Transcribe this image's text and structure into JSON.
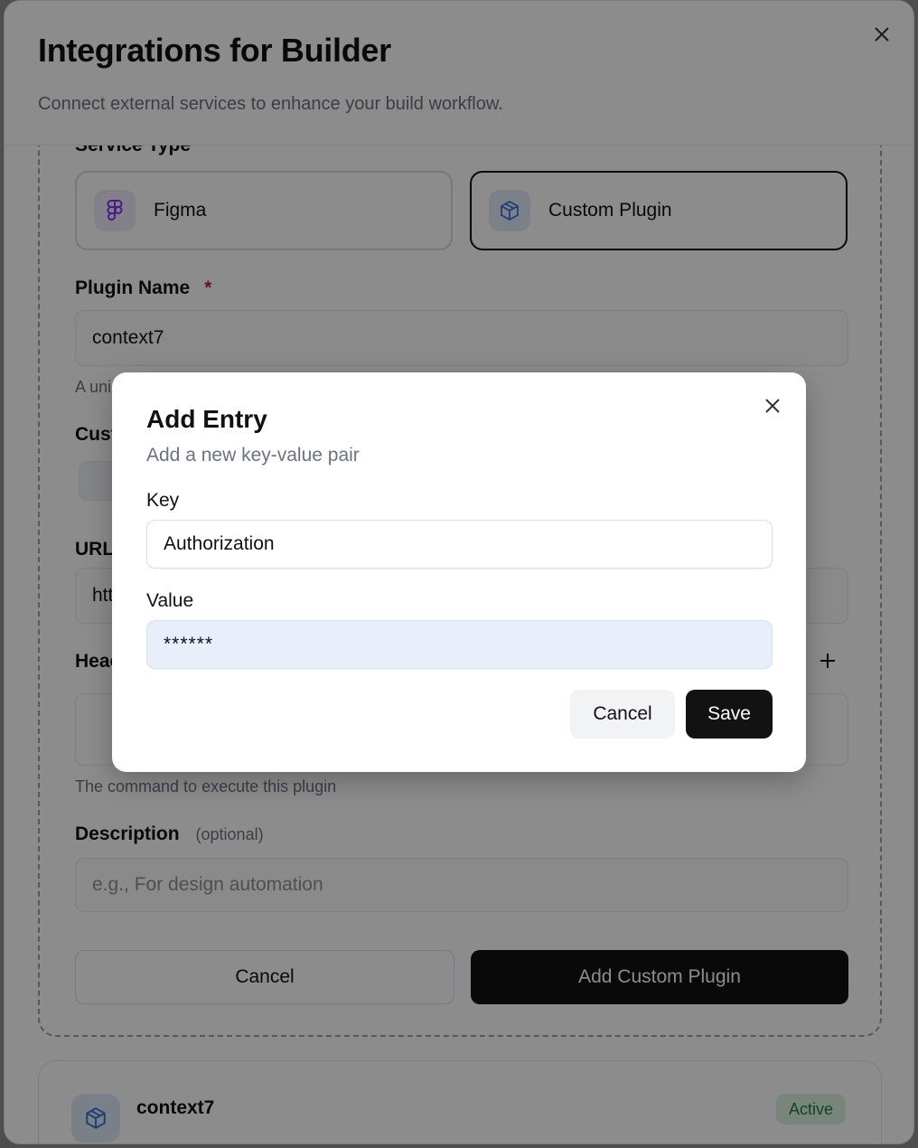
{
  "panel": {
    "title": "Integrations for Builder",
    "subtitle": "Connect external services to enhance your build workflow."
  },
  "form": {
    "service_type_label": "Service Type",
    "services": [
      {
        "label": "Figma",
        "icon": "figma-icon",
        "selected": false
      },
      {
        "label": "Custom Plugin",
        "icon": "box-icon",
        "selected": true
      }
    ],
    "plugin_name_label": "Plugin Name",
    "required_marker": "*",
    "plugin_name_value": "context7",
    "plugin_name_hint": "A uni",
    "custom_label": "Cust",
    "url_label": "URL",
    "url_value": "htt",
    "headers_label": "Heac",
    "command_hint": "The command to execute this plugin",
    "description_label": "Description",
    "description_optional": "(optional)",
    "description_placeholder": "e.g., For design automation",
    "cancel_label": "Cancel",
    "add_label": "Add Custom Plugin"
  },
  "plugin_list": {
    "items": [
      {
        "name": "context7",
        "status": "Active",
        "icon": "box-icon"
      }
    ]
  },
  "dialog": {
    "title": "Add Entry",
    "subtitle": "Add a new key-value pair",
    "key_label": "Key",
    "key_value": "Authorization",
    "value_label": "Value",
    "value_value": "******",
    "cancel_label": "Cancel",
    "save_label": "Save"
  },
  "colors": {
    "primary_button": "#111111",
    "badge_bg": "#d9f2df",
    "badge_text": "#2a7a3f",
    "required": "#c0262d",
    "figma_icon_bg": "#f0e9fb",
    "plugin_icon_bg": "#e2ebf9"
  }
}
